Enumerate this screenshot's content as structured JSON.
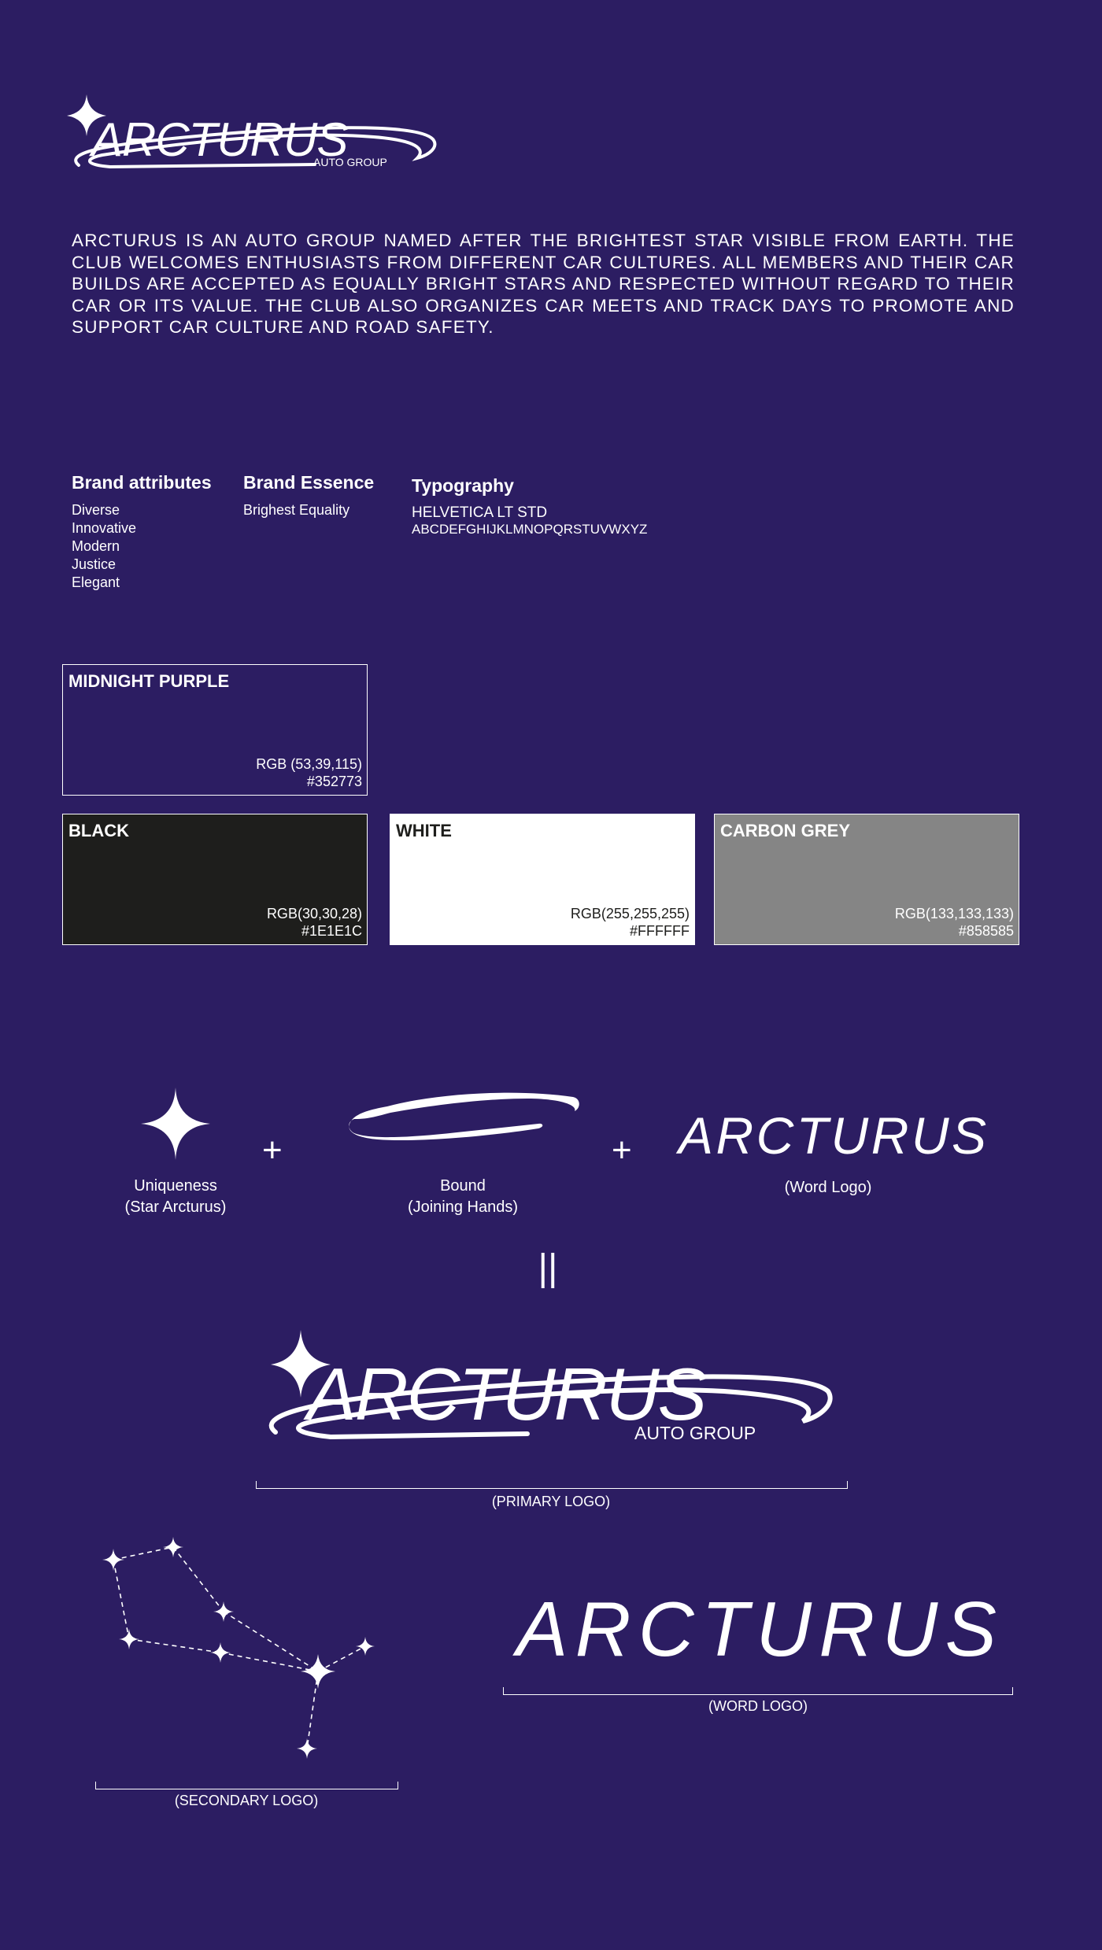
{
  "brand": {
    "name": "ARCTURUS",
    "sub": "AUTO GROUP"
  },
  "intro": "ARCTURUS IS AN AUTO GROUP NAMED AFTER THE BRIGHTEST STAR VISIBLE FROM EARTH. THE CLUB WELCOMES ENTHUSIASTS FROM DIFFERENT CAR CULTURES. ALL MEMBERS AND THEIR CAR BUILDS ARE ACCEPTED AS EQUALLY BRIGHT STARS AND RESPECTED WITHOUT REGARD TO THEIR CAR OR ITS VALUE. THE CLUB ALSO ORGANIZES CAR MEETS AND TRACK DAYS TO PROMOTE AND SUPPORT CAR CULTURE AND ROAD SAFETY.",
  "attributes": {
    "title": "Brand attributes",
    "items": [
      "Diverse",
      "Innovative",
      "Modern",
      "Justice",
      "Elegant"
    ]
  },
  "essence": {
    "title": "Brand Essence",
    "value": "Brighest Equality"
  },
  "typography": {
    "title": "Typography",
    "font": "HELVETICA LT STD",
    "alphabet": "ABCDEFGHIJKLMNOPQRSTUVWXYZ"
  },
  "colors": [
    {
      "name": "MIDNIGHT PURPLE",
      "rgb": "RGB (53,39,115)",
      "hex": "#352773"
    },
    {
      "name": "BLACK",
      "rgb": "RGB(30,30,28)",
      "hex": "#1E1E1C"
    },
    {
      "name": "WHITE",
      "rgb": "RGB(255,255,255)",
      "hex": "#FFFFFF"
    },
    {
      "name": "CARBON GREY",
      "rgb": "RGB(133,133,133)",
      "hex": "#858585"
    }
  ],
  "construction": {
    "plus": "+",
    "equals": "||",
    "star": {
      "line1": "Uniqueness",
      "line2": "(Star Arcturus)"
    },
    "bound": {
      "line1": "Bound",
      "line2": "(Joining Hands)"
    },
    "word": {
      "label": "(Word Logo)"
    }
  },
  "logos": {
    "primary": "(PRIMARY LOGO)",
    "secondary": "(SECONDARY LOGO)",
    "word": "(WORD LOGO)"
  }
}
